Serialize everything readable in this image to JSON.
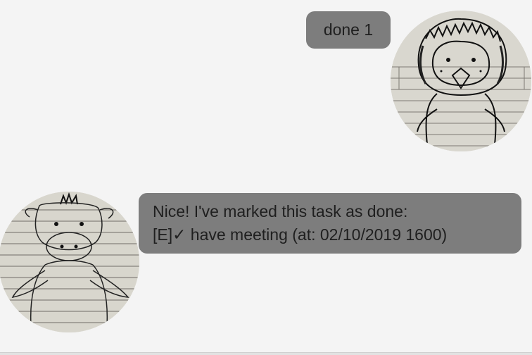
{
  "messages": {
    "user": {
      "text": "done 1"
    },
    "bot": {
      "line1": "Nice! I've marked this task as done:",
      "line2": "[E]✓ have meeting (at: 02/10/2019 1600)"
    }
  },
  "avatars": {
    "user": "penguin-sketch-avatar",
    "bot": "cow-sketch-avatar"
  },
  "colors": {
    "background": "#f4f4f4",
    "bubble": "#7d7d7d",
    "text": "#1f1f1f",
    "paper": "#d8d6cd"
  }
}
